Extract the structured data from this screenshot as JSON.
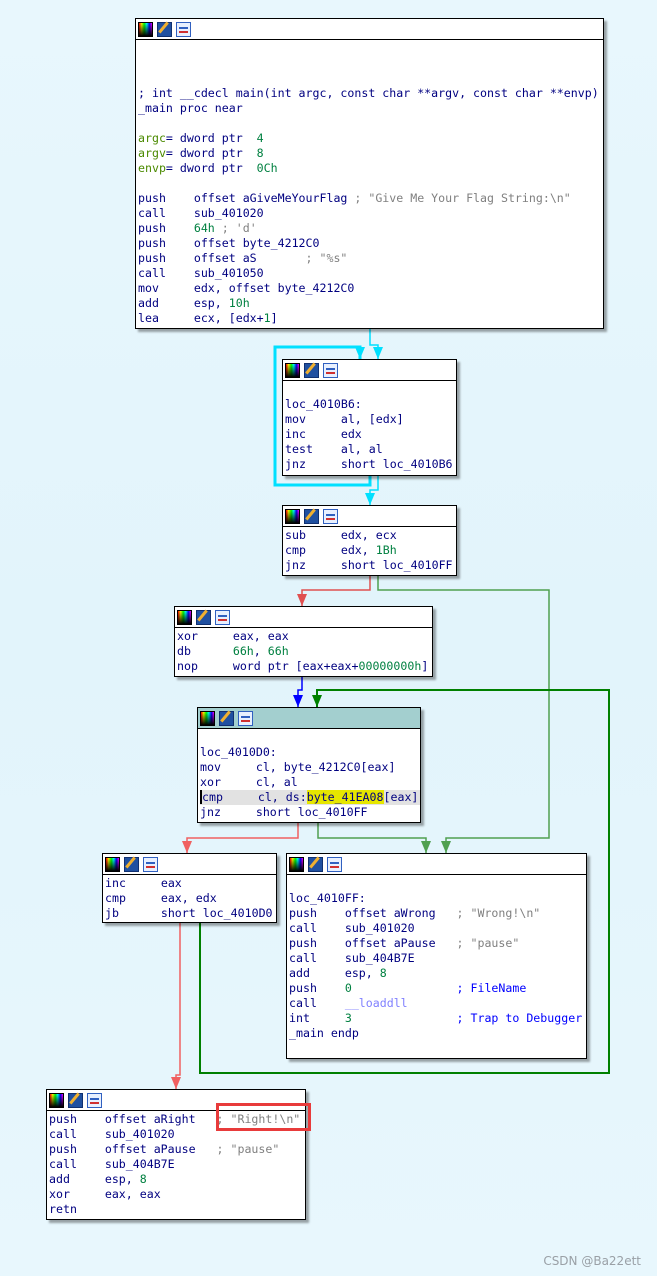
{
  "watermark": "CSDN @Ba22ett",
  "colors": {
    "background": "#e4f5fc",
    "active_header": "#a3cfcf",
    "edge_true": "#008000",
    "edge_false": "#ff0000",
    "edge_uncond": "#0000ff",
    "edge_loop": "#00e0ff",
    "annotation_box": "#e83b3b"
  },
  "header_icons": [
    "color-palette-icon",
    "edit-pencil-icon",
    "graph-overview-icon"
  ],
  "blocks": [
    {
      "id": "main-entry",
      "lines": [
        [],
        [],
        [],
        [
          [
            "m",
            "; int __cdecl main(int argc, const char **argv, const char **envp)"
          ]
        ],
        [
          [
            "m",
            "_main proc near"
          ]
        ],
        [],
        [
          [
            "v",
            "argc"
          ],
          [
            "m",
            "= dword ptr  "
          ],
          [
            "n",
            "4"
          ]
        ],
        [
          [
            "v",
            "argv"
          ],
          [
            "m",
            "= dword ptr  "
          ],
          [
            "n",
            "8"
          ]
        ],
        [
          [
            "v",
            "envp"
          ],
          [
            "m",
            "= dword ptr  "
          ],
          [
            "n",
            "0Ch"
          ]
        ],
        [],
        [
          [
            "m",
            "push    "
          ],
          [
            "o",
            "offset aGiveMeYourFlag "
          ],
          [
            "c",
            "; \"Give Me Your Flag String:\\n\""
          ]
        ],
        [
          [
            "m",
            "call    "
          ],
          [
            "o",
            "sub_401020"
          ]
        ],
        [
          [
            "m",
            "push    "
          ],
          [
            "n",
            "64h"
          ],
          [
            "c",
            " ; 'd'"
          ]
        ],
        [
          [
            "m",
            "push    "
          ],
          [
            "o",
            "offset byte_4212C0"
          ]
        ],
        [
          [
            "m",
            "push    "
          ],
          [
            "o",
            "offset aS       "
          ],
          [
            "c",
            "; \"%s\""
          ]
        ],
        [
          [
            "m",
            "call    "
          ],
          [
            "o",
            "sub_401050"
          ]
        ],
        [
          [
            "m",
            "mov     "
          ],
          [
            "o",
            "edx, offset byte_4212C0"
          ]
        ],
        [
          [
            "m",
            "add     "
          ],
          [
            "o",
            "esp, "
          ],
          [
            "n",
            "10h"
          ]
        ],
        [
          [
            "m",
            "lea     "
          ],
          [
            "o",
            "ecx, [edx+"
          ],
          [
            "n",
            "1"
          ],
          [
            "o",
            "]"
          ]
        ]
      ]
    },
    {
      "id": "loc_4010B6",
      "lines": [
        [],
        [
          [
            "m",
            "loc_4010B6:"
          ]
        ],
        [
          [
            "m",
            "mov     "
          ],
          [
            "o",
            "al, [edx]"
          ]
        ],
        [
          [
            "m",
            "inc     "
          ],
          [
            "o",
            "edx"
          ]
        ],
        [
          [
            "m",
            "test    "
          ],
          [
            "o",
            "al, al"
          ]
        ],
        [
          [
            "m",
            "jnz     "
          ],
          [
            "o",
            "short loc_4010B6"
          ]
        ]
      ]
    },
    {
      "id": "length-check",
      "lines": [
        [
          [
            "m",
            "sub     "
          ],
          [
            "o",
            "edx, ecx"
          ]
        ],
        [
          [
            "m",
            "cmp     "
          ],
          [
            "o",
            "edx, "
          ],
          [
            "n",
            "1Bh"
          ]
        ],
        [
          [
            "m",
            "jnz     "
          ],
          [
            "o",
            "short loc_4010FF"
          ]
        ]
      ]
    },
    {
      "id": "init-loop",
      "lines": [
        [
          [
            "m",
            "xor     "
          ],
          [
            "o",
            "eax, eax"
          ]
        ],
        [
          [
            "m",
            "db      "
          ],
          [
            "n",
            "66h"
          ],
          [
            "o",
            ", "
          ],
          [
            "n",
            "66h"
          ]
        ],
        [
          [
            "m",
            "nop     "
          ],
          [
            "o",
            "word ptr [eax+eax+"
          ],
          [
            "n",
            "00000000h"
          ],
          [
            "o",
            "]"
          ]
        ]
      ]
    },
    {
      "id": "loc_4010D0",
      "active": true,
      "lines": [
        [],
        [
          [
            "m",
            "loc_4010D0:"
          ]
        ],
        [
          [
            "m",
            "mov     "
          ],
          [
            "o",
            "cl, byte_4212C0[eax]"
          ]
        ],
        [
          [
            "m",
            "xor     "
          ],
          [
            "o",
            "cl, al"
          ]
        ],
        [
          [
            "m",
            "cmp     "
          ],
          [
            "o",
            "cl, ds:"
          ],
          [
            "h",
            "byte_41EA08"
          ],
          [
            "o",
            "[eax]"
          ]
        ],
        [
          [
            "m",
            "jnz     "
          ],
          [
            "o",
            "short loc_4010FF"
          ]
        ]
      ]
    },
    {
      "id": "loop-increment",
      "lines": [
        [
          [
            "m",
            "inc     "
          ],
          [
            "o",
            "eax"
          ]
        ],
        [
          [
            "m",
            "cmp     "
          ],
          [
            "o",
            "eax, edx"
          ]
        ],
        [
          [
            "m",
            "jb      "
          ],
          [
            "o",
            "short loc_4010D0"
          ]
        ]
      ]
    },
    {
      "id": "loc_4010FF",
      "lines": [
        [],
        [
          [
            "m",
            "loc_4010FF:"
          ]
        ],
        [
          [
            "m",
            "push    "
          ],
          [
            "o",
            "offset aWrong   "
          ],
          [
            "c",
            "; \"Wrong!\\n\""
          ]
        ],
        [
          [
            "m",
            "call    "
          ],
          [
            "o",
            "sub_401020"
          ]
        ],
        [
          [
            "m",
            "push    "
          ],
          [
            "o",
            "offset aPause   "
          ],
          [
            "c",
            "; \"pause\""
          ]
        ],
        [
          [
            "m",
            "call    "
          ],
          [
            "o",
            "sub_404B7E"
          ]
        ],
        [
          [
            "m",
            "add     "
          ],
          [
            "o",
            "esp, "
          ],
          [
            "n",
            "8"
          ]
        ],
        [
          [
            "m",
            "push    "
          ],
          [
            "n",
            "0"
          ],
          [
            "o",
            "               "
          ],
          [
            "b",
            "; FileName"
          ]
        ],
        [
          [
            "m",
            "call    "
          ],
          [
            "i",
            "__loaddll"
          ]
        ],
        [
          [
            "m",
            "int     "
          ],
          [
            "n",
            "3"
          ],
          [
            "o",
            "               "
          ],
          [
            "b",
            "; Trap to Debugger"
          ]
        ],
        [
          [
            "m",
            "_main endp"
          ]
        ],
        []
      ]
    },
    {
      "id": "right-branch",
      "lines": [
        [
          [
            "m",
            "push    "
          ],
          [
            "o",
            "offset aRight   "
          ],
          [
            "c",
            "; \"Right!\\n\""
          ]
        ],
        [
          [
            "m",
            "call    "
          ],
          [
            "o",
            "sub_401020"
          ]
        ],
        [
          [
            "m",
            "push    "
          ],
          [
            "o",
            "offset aPause   "
          ],
          [
            "c",
            "; \"pause\""
          ]
        ],
        [
          [
            "m",
            "call    "
          ],
          [
            "o",
            "sub_404B7E"
          ]
        ],
        [
          [
            "m",
            "add     "
          ],
          [
            "o",
            "esp, "
          ],
          [
            "n",
            "8"
          ]
        ],
        [
          [
            "m",
            "xor     "
          ],
          [
            "o",
            "eax, eax"
          ]
        ],
        [
          [
            "m",
            "retn"
          ]
        ]
      ]
    }
  ]
}
